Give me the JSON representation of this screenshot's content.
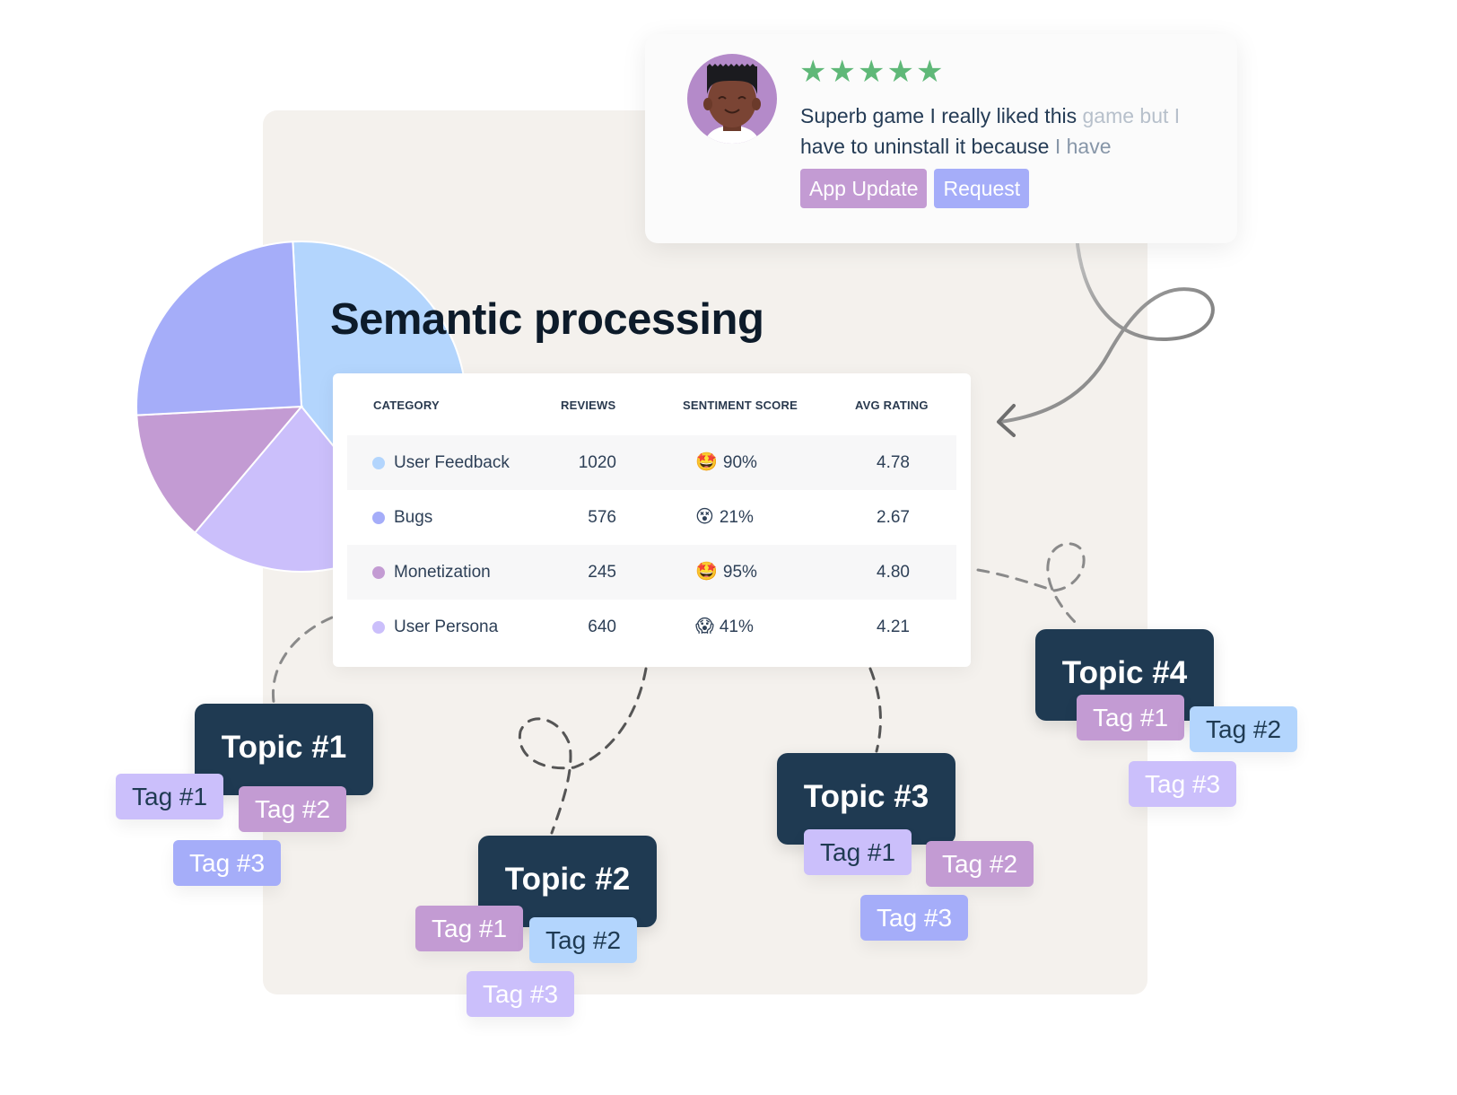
{
  "title": "Semantic processing",
  "review": {
    "rating": 5,
    "star_glyph": "★",
    "text_main": "Superb game I really liked this ",
    "text_fade1": "game but I",
    "text_line2_main": "have to uninstall it because ",
    "text_line2_fade": "I have",
    "tags": [
      {
        "label": "App Update",
        "color": "#c39bd3"
      },
      {
        "label": "Request",
        "color": "#a5adf9"
      }
    ],
    "star_color": "#5fb878"
  },
  "table": {
    "headers": [
      "CATEGORY",
      "REVIEWS",
      "SENTIMENT SCORE",
      "AVG RATING"
    ],
    "rows": [
      {
        "category": "User Feedback",
        "dot_color": "#b3d5fd",
        "reviews": "1020",
        "emoji": "🤩",
        "sentiment": "90%",
        "avg_rating": "4.78"
      },
      {
        "category": "Bugs",
        "dot_color": "#a5adf9",
        "reviews": "576",
        "emoji": "😵",
        "sentiment": "21%",
        "avg_rating": "2.67"
      },
      {
        "category": "Monetization",
        "dot_color": "#c39bd3",
        "reviews": "245",
        "emoji": "🤩",
        "sentiment": "95%",
        "avg_rating": "4.80"
      },
      {
        "category": "User Persona",
        "dot_color": "#cbbffb",
        "reviews": "640",
        "emoji": "😱",
        "sentiment": "41%",
        "avg_rating": "4.21"
      }
    ]
  },
  "chart_data": {
    "type": "pie",
    "title": "",
    "labels": [
      "User Feedback",
      "User Persona",
      "Monetization",
      "Bugs"
    ],
    "values": [
      40,
      22,
      13,
      25
    ],
    "colors": [
      "#b3d5fd",
      "#cbbffb",
      "#c39bd3",
      "#a5adf9"
    ],
    "start_angle_deg": -3
  },
  "topics": [
    {
      "label": "Topic #1",
      "tags": [
        "Tag #1",
        "Tag #2",
        "Tag #3"
      ]
    },
    {
      "label": "Topic #2",
      "tags": [
        "Tag #1",
        "Tag #2",
        "Tag #3"
      ]
    },
    {
      "label": "Topic #3",
      "tags": [
        "Tag #1",
        "Tag #2",
        "Tag #3"
      ]
    },
    {
      "label": "Topic #4",
      "tags": [
        "Tag #1",
        "Tag #2",
        "Tag #3"
      ]
    }
  ],
  "colors": {
    "topic_bg": "#1f3a52",
    "panel_bg": "#f4f1ed",
    "connector": "#6b6b6b"
  }
}
